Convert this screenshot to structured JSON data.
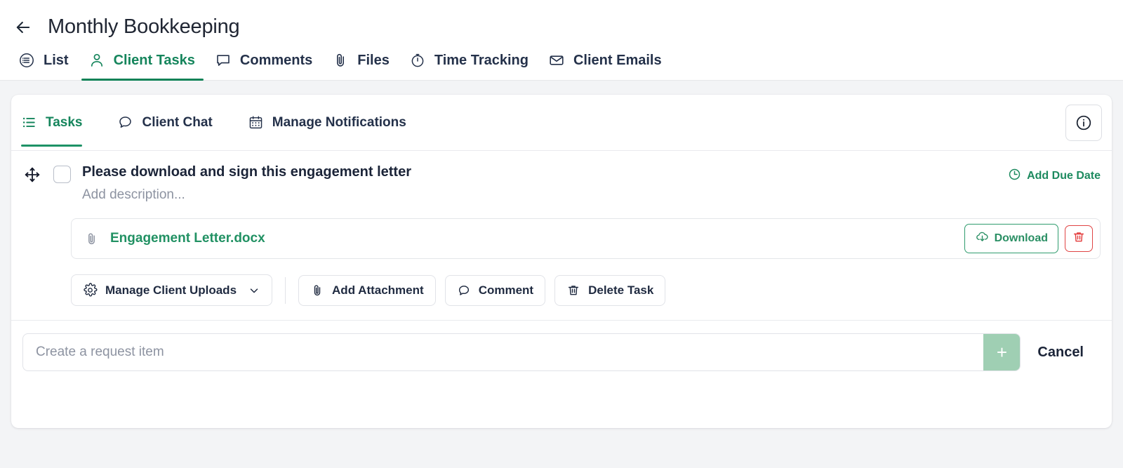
{
  "header": {
    "back_icon": "arrow-left-icon",
    "title": "Monthly Bookkeeping"
  },
  "main_tabs": [
    {
      "label": "List",
      "icon": "list-circle-icon",
      "active": false
    },
    {
      "label": "Client Tasks",
      "icon": "user-icon",
      "active": true
    },
    {
      "label": "Comments",
      "icon": "comment-icon",
      "active": false
    },
    {
      "label": "Files",
      "icon": "paperclip-icon",
      "active": false
    },
    {
      "label": "Time Tracking",
      "icon": "stopwatch-icon",
      "active": false
    },
    {
      "label": "Client Emails",
      "icon": "envelope-icon",
      "active": false
    }
  ],
  "card_tabs": [
    {
      "label": "Tasks",
      "icon": "list-bullets-icon",
      "active": true
    },
    {
      "label": "Client Chat",
      "icon": "chat-bubble-icon",
      "active": false
    },
    {
      "label": "Manage Notifications",
      "icon": "calendar-icon",
      "active": false
    }
  ],
  "info_button": {
    "icon": "info-circle-icon"
  },
  "task": {
    "drag_icon": "move-arrows-icon",
    "checkbox_checked": false,
    "title": "Please download and sign this engagement letter",
    "description_placeholder": "Add description...",
    "due_date": {
      "label": "Add Due Date",
      "icon": "clock-icon"
    },
    "attachment": {
      "icon": "paperclip-icon",
      "name": "Engagement Letter.docx",
      "download_label": "Download",
      "download_icon": "cloud-download-icon",
      "delete_icon": "trash-icon"
    },
    "actions": [
      {
        "label": "Manage Client Uploads",
        "icon": "gear-icon",
        "chevron": "chevron-down-icon"
      },
      {
        "label": "Add Attachment",
        "icon": "paperclip-icon"
      },
      {
        "label": "Comment",
        "icon": "comment-icon"
      },
      {
        "label": "Delete Task",
        "icon": "trash-icon"
      }
    ]
  },
  "create_row": {
    "placeholder": "Create a request item",
    "value": "",
    "add_label": "+",
    "cancel_label": "Cancel"
  },
  "colors": {
    "accent_green": "#1d8a5f",
    "danger_red": "#e33b3b",
    "text_dark": "#1b2438",
    "muted": "#8d93a1",
    "page_bg": "#f3f4f6"
  }
}
